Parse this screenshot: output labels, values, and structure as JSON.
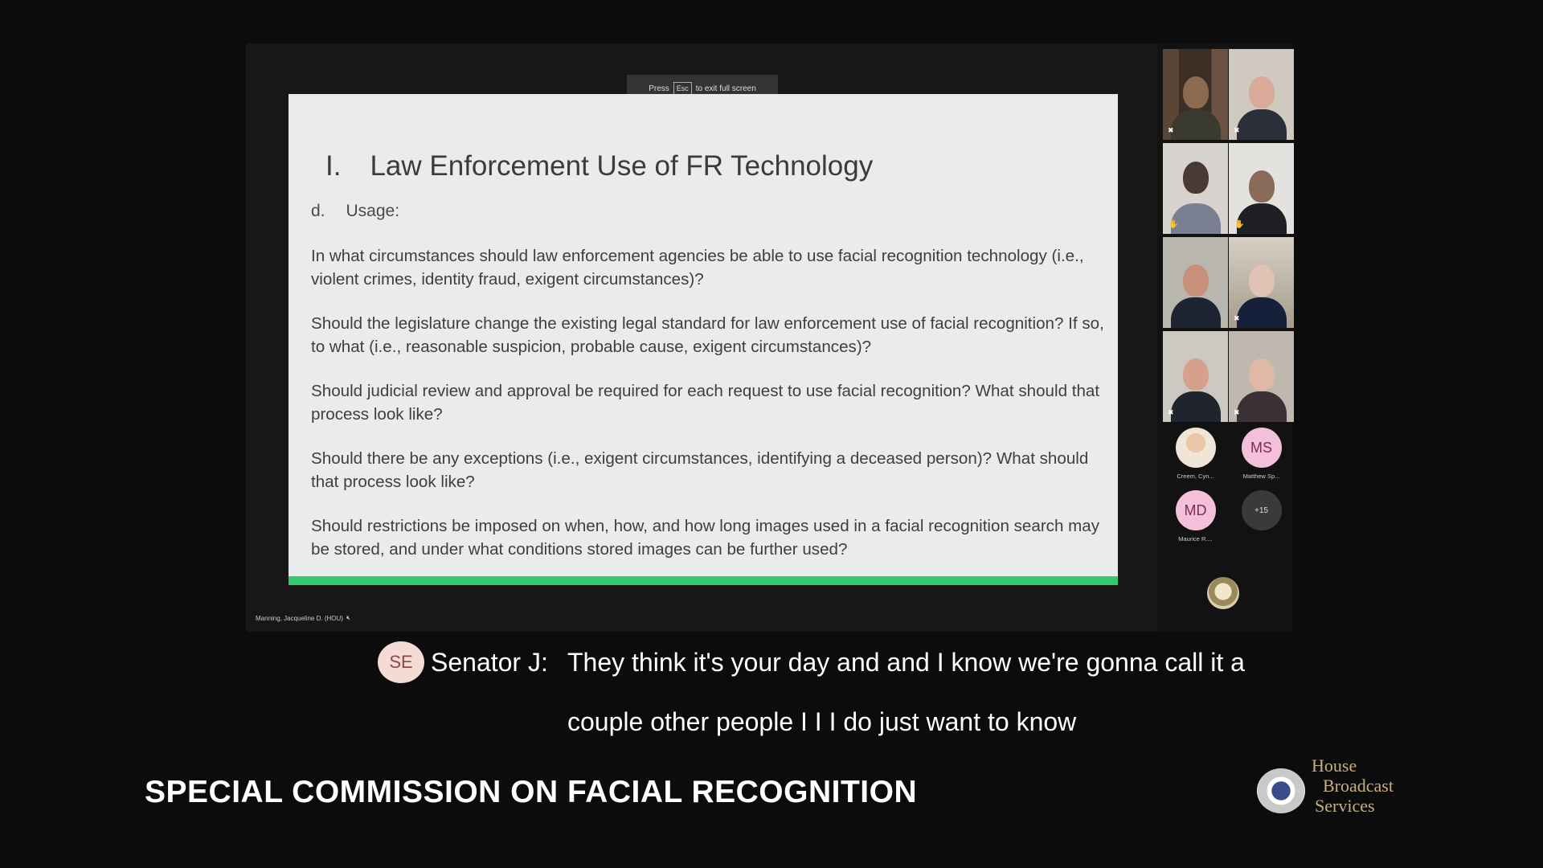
{
  "slide": {
    "title_number": "I.",
    "title_text": "Law Enforcement Use of FR Technology",
    "sub_letter": "d.",
    "sub_text": "Usage:",
    "questions": [
      "In what circumstances should law enforcement agencies be able to use facial recognition technology (i.e., violent crimes, identity fraud, exigent circumstances)?",
      "Should the legislature change the existing legal standard for law enforcement use of facial recognition? If so, to what (i.e., reasonable suspicion, probable cause, exigent circumstances)?",
      "Should judicial review and approval be required for each request to use facial recognition? What should that process look like?",
      "Should there be any exceptions (i.e., exigent circumstances, identifying a deceased person)? What should that process look like?",
      "Should restrictions be imposed on when, how, and how long images used in a facial recognition search may be stored, and under what conditions stored images can be further used?"
    ],
    "accent_color": "#33c96f"
  },
  "fullscreen_toast": {
    "before": "Press",
    "key": "Esc",
    "after": "to exit full screen"
  },
  "presenter": {
    "name": "Manning, Jacqueline D. (HOU)",
    "mic_icon": "mic-muted-icon"
  },
  "gallery": {
    "avatars": [
      {
        "initials": "",
        "label": "Creem, Cyn...",
        "color": "#f0e6d8"
      },
      {
        "initials": "MS",
        "label": "Matthew Sp...",
        "color": "#f3bfd9"
      },
      {
        "initials": "MD",
        "label": "Maurice R....",
        "color": "#f3bfd9"
      },
      {
        "initials": "+15",
        "label": "",
        "color": "#3a3a3a"
      }
    ]
  },
  "caption": {
    "badge": "SE",
    "speaker": "Senator J:",
    "line1": "They think it's your day and and I know we're gonna call it a",
    "line2": "couple other people I I I do just want to know"
  },
  "lower_third": {
    "title": "SPECIAL COMMISSION ON FACIAL RECOGNITION"
  },
  "brand": {
    "line1": "House",
    "line2": "Broadcast",
    "line3": "Services",
    "color": "#c8b07a"
  }
}
